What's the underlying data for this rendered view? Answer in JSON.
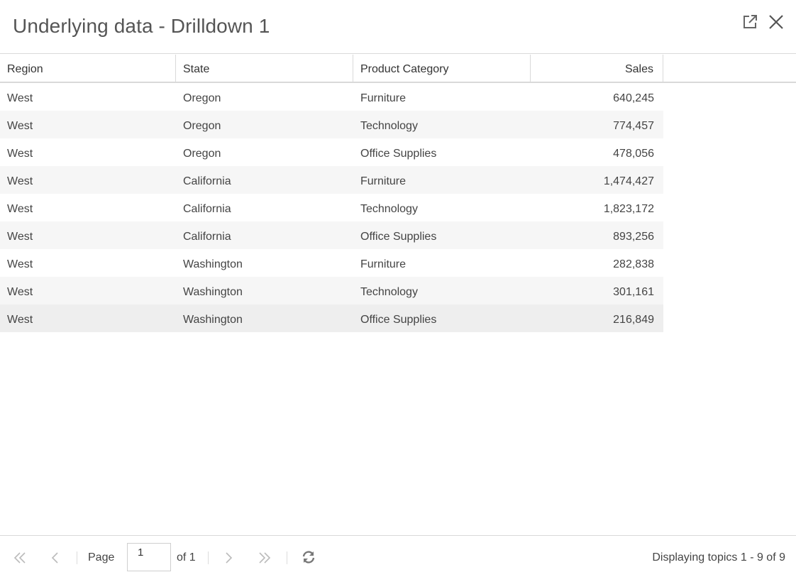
{
  "dialog": {
    "title": "Underlying data - Drilldown 1",
    "popout_icon": "external-link-icon",
    "close_icon": "close-icon"
  },
  "table": {
    "columns": [
      "Region",
      "State",
      "Product Category",
      "Sales"
    ],
    "rows": [
      [
        "West",
        "Oregon",
        "Furniture",
        "640,245"
      ],
      [
        "West",
        "Oregon",
        "Technology",
        "774,457"
      ],
      [
        "West",
        "Oregon",
        "Office Supplies",
        "478,056"
      ],
      [
        "West",
        "California",
        "Furniture",
        "1,474,427"
      ],
      [
        "West",
        "California",
        "Technology",
        "1,823,172"
      ],
      [
        "West",
        "California",
        "Office Supplies",
        "893,256"
      ],
      [
        "West",
        "Washington",
        "Furniture",
        "282,838"
      ],
      [
        "West",
        "Washington",
        "Technology",
        "301,161"
      ],
      [
        "West",
        "Washington",
        "Office Supplies",
        "216,849"
      ]
    ]
  },
  "pager": {
    "page_label": "Page",
    "page_value": "1",
    "of_label": "of 1",
    "status": "Displaying topics 1 - 9 of 9",
    "icons": [
      "first-page-icon",
      "prev-page-icon",
      "next-page-icon",
      "last-page-icon",
      "refresh-icon"
    ]
  }
}
